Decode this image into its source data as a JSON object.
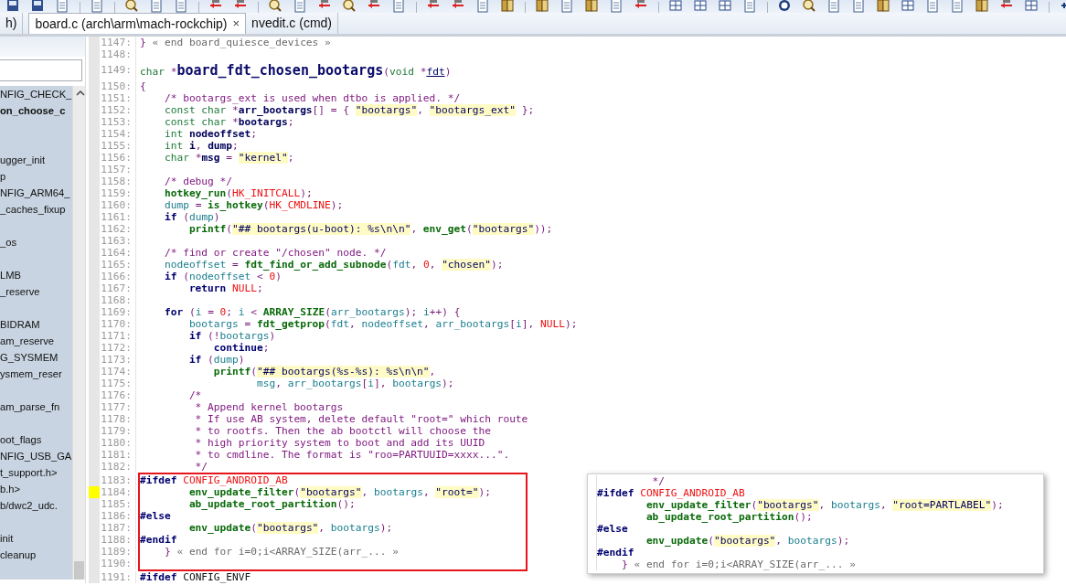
{
  "tabs": [
    {
      "label": "h)",
      "selected": false,
      "closable": false
    },
    {
      "label": "board.c (arch\\arm\\mach-rockchip)",
      "selected": true,
      "closable": true,
      "close_glyph": "×"
    },
    {
      "label": "nvedit.c (cmd)",
      "selected": false,
      "closable": false
    }
  ],
  "sidebar": {
    "items": [
      {
        "kind": "symbol",
        "text": "NFIG_CHECK_",
        "selected": false
      },
      {
        "kind": "symbol",
        "text": "on_choose_c",
        "selected": true
      },
      {
        "kind": "clipped"
      },
      {
        "kind": "clipped"
      },
      {
        "kind": "symbol",
        "text": "ugger_init",
        "selected": false
      },
      {
        "kind": "symbol",
        "text": "p",
        "selected": false
      },
      {
        "kind": "symbol",
        "text": "NFIG_ARM64_",
        "selected": false
      },
      {
        "kind": "symbol",
        "text": "_caches_fixup",
        "selected": false
      },
      {
        "kind": "clipped"
      },
      {
        "kind": "symbol",
        "text": "_os",
        "selected": false
      },
      {
        "kind": "clipped"
      },
      {
        "kind": "symbol",
        "text": "LMB",
        "selected": false
      },
      {
        "kind": "symbol",
        "text": "_reserve",
        "selected": false
      },
      {
        "kind": "clipped"
      },
      {
        "kind": "symbol",
        "text": "BIDRAM",
        "selected": false
      },
      {
        "kind": "symbol",
        "text": "am_reserve",
        "selected": false
      },
      {
        "kind": "symbol",
        "text": "G_SYSMEM",
        "selected": false
      },
      {
        "kind": "symbol",
        "text": "ysmem_reser",
        "selected": false
      },
      {
        "kind": "clipped"
      },
      {
        "kind": "symbol",
        "text": "am_parse_fn",
        "selected": false
      },
      {
        "kind": "clipped"
      },
      {
        "kind": "symbol",
        "text": "oot_flags",
        "selected": false
      },
      {
        "kind": "symbol",
        "text": "NFIG_USB_GA",
        "selected": false
      },
      {
        "kind": "symbol",
        "text": "t_support.h>",
        "selected": false
      },
      {
        "kind": "symbol",
        "text": "b.h>",
        "selected": false
      },
      {
        "kind": "symbol",
        "text": "b/dwc2_udc.",
        "selected": false
      },
      {
        "kind": "clipped"
      },
      {
        "kind": "symbol",
        "text": "init",
        "selected": false
      },
      {
        "kind": "symbol",
        "text": "cleanup",
        "selected": false
      }
    ]
  },
  "editor": {
    "sections": [
      {
        "kind": "plain",
        "lines": [
          {
            "number": "1147:",
            "bookmarked": false,
            "tokens": [
              {
                "kind": "p",
                "text": "} "
              },
              {
                "kind": "fold",
                "text": "« end board_quiesce_devices »"
              }
            ]
          },
          {
            "number": "1148:",
            "bookmarked": false
          },
          {
            "number": "1149:",
            "bookmarked": false,
            "tokens": [
              {
                "kind": "ty",
                "text": "char"
              },
              {
                "kind": "p",
                "text": " *"
              },
              {
                "kind": "fname",
                "text": "board_fdt_chosen_bootargs"
              },
              {
                "kind": "p",
                "text": "("
              },
              {
                "kind": "ty",
                "text": "void"
              },
              {
                "kind": "p",
                "text": " *"
              },
              {
                "kind": "param",
                "text": "fdt"
              },
              {
                "kind": "p",
                "text": ")"
              }
            ]
          },
          {
            "number": "1150:",
            "bookmarked": false,
            "tokens": [
              {
                "kind": "p",
                "text": "{"
              }
            ]
          },
          {
            "number": "1151:",
            "bookmarked": false,
            "tokens": [
              {
                "kind": "cm",
                "text": "    /* bootargs_ext is used when dtbo is applied. */"
              }
            ]
          },
          {
            "number": "1152:",
            "bookmarked": false,
            "tokens": [
              {
                "kind": "ty",
                "text": "    const char"
              },
              {
                "kind": "p",
                "text": " *"
              },
              {
                "kind": "def",
                "text": "arr_bootargs"
              },
              {
                "kind": "p",
                "text": "[] = { "
              },
              {
                "kind": "str",
                "text": "\"bootargs\""
              },
              {
                "kind": "p",
                "text": ", "
              },
              {
                "kind": "str",
                "text": "\"bootargs_ext\""
              },
              {
                "kind": "p",
                "text": " };"
              }
            ]
          },
          {
            "number": "1153:",
            "bookmarked": false,
            "tokens": [
              {
                "kind": "ty",
                "text": "    const char"
              },
              {
                "kind": "p",
                "text": " *"
              },
              {
                "kind": "def",
                "text": "bootargs"
              },
              {
                "kind": "p",
                "text": ";"
              }
            ]
          },
          {
            "number": "1154:",
            "bookmarked": false,
            "tokens": [
              {
                "kind": "ty",
                "text": "    int "
              },
              {
                "kind": "def",
                "text": "nodeoffset"
              },
              {
                "kind": "p",
                "text": ";"
              }
            ]
          },
          {
            "number": "1155:",
            "bookmarked": false,
            "tokens": [
              {
                "kind": "ty",
                "text": "    int "
              },
              {
                "kind": "def",
                "text": "i"
              },
              {
                "kind": "p",
                "text": ", "
              },
              {
                "kind": "def",
                "text": "dump"
              },
              {
                "kind": "p",
                "text": ";"
              }
            ]
          },
          {
            "number": "1156:",
            "bookmarked": false,
            "tokens": [
              {
                "kind": "ty",
                "text": "    char"
              },
              {
                "kind": "p",
                "text": " *"
              },
              {
                "kind": "def",
                "text": "msg"
              },
              {
                "kind": "p",
                "text": " = "
              },
              {
                "kind": "str",
                "text": "\"kernel\""
              },
              {
                "kind": "p",
                "text": ";"
              }
            ]
          },
          {
            "number": "1157:",
            "bookmarked": false
          },
          {
            "number": "1158:",
            "bookmarked": false,
            "tokens": [
              {
                "kind": "cm",
                "text": "    /* debug */"
              }
            ]
          },
          {
            "number": "1159:",
            "bookmarked": false,
            "tokens": [
              {
                "kind": "fn",
                "text": "    hotkey_run"
              },
              {
                "kind": "p",
                "text": "("
              },
              {
                "kind": "mac",
                "text": "HK_INITCALL"
              },
              {
                "kind": "p",
                "text": ");"
              }
            ]
          },
          {
            "number": "1160:",
            "bookmarked": false,
            "tokens": [
              {
                "kind": "id",
                "text": "    dump"
              },
              {
                "kind": "p",
                "text": " = "
              },
              {
                "kind": "fn",
                "text": "is_hotkey"
              },
              {
                "kind": "p",
                "text": "("
              },
              {
                "kind": "mac",
                "text": "HK_CMDLINE"
              },
              {
                "kind": "p",
                "text": ");"
              }
            ]
          },
          {
            "number": "1161:",
            "bookmarked": false,
            "tokens": [
              {
                "kind": "kw",
                "text": "    if"
              },
              {
                "kind": "p",
                "text": " ("
              },
              {
                "kind": "id",
                "text": "dump"
              },
              {
                "kind": "p",
                "text": ")"
              }
            ]
          },
          {
            "number": "1162:",
            "bookmarked": false,
            "tokens": [
              {
                "kind": "fn",
                "text": "        printf"
              },
              {
                "kind": "p",
                "text": "("
              },
              {
                "kind": "str",
                "text": "\"## bootargs(u-boot): %s\\n\\n\""
              },
              {
                "kind": "p",
                "text": ", "
              },
              {
                "kind": "fn",
                "text": "env_get"
              },
              {
                "kind": "p",
                "text": "("
              },
              {
                "kind": "str",
                "text": "\"bootargs\""
              },
              {
                "kind": "p",
                "text": "));"
              }
            ]
          },
          {
            "number": "1163:",
            "bookmarked": false
          },
          {
            "number": "1164:",
            "bookmarked": false,
            "tokens": [
              {
                "kind": "cm",
                "text": "    /* find or create \"/chosen\" node. */"
              }
            ]
          },
          {
            "number": "1165:",
            "bookmarked": false,
            "tokens": [
              {
                "kind": "id",
                "text": "    nodeoffset"
              },
              {
                "kind": "p",
                "text": " = "
              },
              {
                "kind": "fn",
                "text": "fdt_find_or_add_subnode"
              },
              {
                "kind": "p",
                "text": "("
              },
              {
                "kind": "id",
                "text": "fdt"
              },
              {
                "kind": "p",
                "text": ", "
              },
              {
                "kind": "mac",
                "text": "0"
              },
              {
                "kind": "p",
                "text": ", "
              },
              {
                "kind": "str",
                "text": "\"chosen\""
              },
              {
                "kind": "p",
                "text": ");"
              }
            ]
          },
          {
            "number": "1166:",
            "bookmarked": false,
            "tokens": [
              {
                "kind": "kw",
                "text": "    if"
              },
              {
                "kind": "p",
                "text": " ("
              },
              {
                "kind": "id",
                "text": "nodeoffset"
              },
              {
                "kind": "p",
                "text": " < "
              },
              {
                "kind": "mac",
                "text": "0"
              },
              {
                "kind": "p",
                "text": ")"
              }
            ]
          },
          {
            "number": "1167:",
            "bookmarked": false,
            "tokens": [
              {
                "kind": "kw",
                "text": "        return "
              },
              {
                "kind": "mac",
                "text": "NULL"
              },
              {
                "kind": "p",
                "text": ";"
              }
            ]
          },
          {
            "number": "1168:",
            "bookmarked": false
          },
          {
            "number": "1169:",
            "bookmarked": false,
            "tokens": [
              {
                "kind": "kw",
                "text": "    for"
              },
              {
                "kind": "p",
                "text": " ("
              },
              {
                "kind": "id",
                "text": "i"
              },
              {
                "kind": "p",
                "text": " = "
              },
              {
                "kind": "mac",
                "text": "0"
              },
              {
                "kind": "p",
                "text": "; "
              },
              {
                "kind": "id",
                "text": "i"
              },
              {
                "kind": "p",
                "text": " < "
              },
              {
                "kind": "fn",
                "text": "ARRAY_SIZE"
              },
              {
                "kind": "p",
                "text": "("
              },
              {
                "kind": "id",
                "text": "arr_bootargs"
              },
              {
                "kind": "p",
                "text": "); "
              },
              {
                "kind": "id",
                "text": "i"
              },
              {
                "kind": "p",
                "text": "++) {"
              }
            ]
          },
          {
            "number": "1170:",
            "bookmarked": false,
            "tokens": [
              {
                "kind": "id",
                "text": "        bootargs"
              },
              {
                "kind": "p",
                "text": " = "
              },
              {
                "kind": "fn",
                "text": "fdt_getprop"
              },
              {
                "kind": "p",
                "text": "("
              },
              {
                "kind": "id",
                "text": "fdt"
              },
              {
                "kind": "p",
                "text": ", "
              },
              {
                "kind": "id",
                "text": "nodeoffset"
              },
              {
                "kind": "p",
                "text": ", "
              },
              {
                "kind": "id",
                "text": "arr_bootargs"
              },
              {
                "kind": "p",
                "text": "["
              },
              {
                "kind": "id",
                "text": "i"
              },
              {
                "kind": "p",
                "text": "], "
              },
              {
                "kind": "mac",
                "text": "NULL"
              },
              {
                "kind": "p",
                "text": ");"
              }
            ]
          },
          {
            "number": "1171:",
            "bookmarked": false,
            "tokens": [
              {
                "kind": "kw",
                "text": "        if"
              },
              {
                "kind": "p",
                "text": " (!"
              },
              {
                "kind": "id",
                "text": "bootargs"
              },
              {
                "kind": "p",
                "text": ")"
              }
            ]
          },
          {
            "number": "1172:",
            "bookmarked": false,
            "tokens": [
              {
                "kind": "kw",
                "text": "            continue"
              },
              {
                "kind": "p",
                "text": ";"
              }
            ]
          },
          {
            "number": "1173:",
            "bookmarked": false,
            "tokens": [
              {
                "kind": "kw",
                "text": "        if"
              },
              {
                "kind": "p",
                "text": " ("
              },
              {
                "kind": "id",
                "text": "dump"
              },
              {
                "kind": "p",
                "text": ")"
              }
            ]
          },
          {
            "number": "1174:",
            "bookmarked": false,
            "tokens": [
              {
                "kind": "fn",
                "text": "            printf"
              },
              {
                "kind": "p",
                "text": "("
              },
              {
                "kind": "str",
                "text": "\"## bootargs(%s-%s): %s\\n\\n\""
              },
              {
                "kind": "p",
                "text": ","
              }
            ]
          },
          {
            "number": "1175:",
            "bookmarked": false,
            "tokens": [
              {
                "kind": "id",
                "text": "                   msg"
              },
              {
                "kind": "p",
                "text": ", "
              },
              {
                "kind": "id",
                "text": "arr_bootargs"
              },
              {
                "kind": "p",
                "text": "["
              },
              {
                "kind": "id",
                "text": "i"
              },
              {
                "kind": "p",
                "text": "], "
              },
              {
                "kind": "id",
                "text": "bootargs"
              },
              {
                "kind": "p",
                "text": ");"
              }
            ]
          },
          {
            "number": "1176:",
            "bookmarked": false,
            "tokens": [
              {
                "kind": "cm",
                "text": "        /*"
              }
            ]
          },
          {
            "number": "1177:",
            "bookmarked": false,
            "tokens": [
              {
                "kind": "cm",
                "text": "         * Append kernel bootargs"
              }
            ]
          },
          {
            "number": "1178:",
            "bookmarked": false,
            "tokens": [
              {
                "kind": "cm",
                "text": "         * If use AB system, delete default \"root=\" which route"
              }
            ]
          },
          {
            "number": "1179:",
            "bookmarked": false,
            "tokens": [
              {
                "kind": "cm",
                "text": "         * to rootfs. Then the ab bootctl will choose the"
              }
            ]
          },
          {
            "number": "1180:",
            "bookmarked": false,
            "tokens": [
              {
                "kind": "cm",
                "text": "         * high priority system to boot and add its UUID"
              }
            ]
          },
          {
            "number": "1181:",
            "bookmarked": false,
            "tokens": [
              {
                "kind": "cm",
                "text": "         * to cmdline. The format is \"roo=PARTUUID=xxxx...\"."
              }
            ]
          },
          {
            "number": "1182:",
            "bookmarked": false,
            "tokens": [
              {
                "kind": "cm",
                "text": "         */"
              }
            ]
          }
        ]
      },
      {
        "kind": "boxed",
        "lines": [
          {
            "number": "1183:",
            "bookmarked": false,
            "tokens": [
              {
                "kind": "kw",
                "text": "#ifdef "
              },
              {
                "kind": "mac",
                "text": "CONFIG_ANDROID_AB"
              }
            ]
          },
          {
            "number": "1184:",
            "bookmarked": true,
            "tokens": [
              {
                "kind": "fn",
                "text": "        env_update_filter"
              },
              {
                "kind": "p",
                "text": "("
              },
              {
                "kind": "str",
                "text": "\"bootargs\""
              },
              {
                "kind": "p",
                "text": ", "
              },
              {
                "kind": "id",
                "text": "bootargs"
              },
              {
                "kind": "p",
                "text": ", "
              },
              {
                "kind": "str",
                "text": "\"root=\""
              },
              {
                "kind": "p",
                "text": ");"
              }
            ]
          },
          {
            "number": "1185:",
            "bookmarked": false,
            "tokens": [
              {
                "kind": "fn",
                "text": "        ab_update_root_partition"
              },
              {
                "kind": "p",
                "text": "();"
              }
            ]
          },
          {
            "number": "1186:",
            "bookmarked": false,
            "tokens": [
              {
                "kind": "kw",
                "text": "#else"
              }
            ]
          },
          {
            "number": "1187:",
            "bookmarked": false,
            "tokens": [
              {
                "kind": "fn",
                "text": "        env_update"
              },
              {
                "kind": "p",
                "text": "("
              },
              {
                "kind": "str",
                "text": "\"bootargs\""
              },
              {
                "kind": "p",
                "text": ", "
              },
              {
                "kind": "id",
                "text": "bootargs"
              },
              {
                "kind": "p",
                "text": ");"
              }
            ]
          },
          {
            "number": "1188:",
            "bookmarked": false,
            "tokens": [
              {
                "kind": "kw",
                "text": "#endif"
              }
            ]
          },
          {
            "number": "1189:",
            "bookmarked": false,
            "tokens": [
              {
                "kind": "p",
                "text": "    } "
              },
              {
                "kind": "fold",
                "text": "« end for i=0;i<ARRAY_SIZE(arr_... »"
              }
            ]
          },
          {
            "number": "1190:",
            "bookmarked": false
          }
        ]
      },
      {
        "kind": "plain",
        "lines": [
          {
            "number": "1191:",
            "bookmarked": false,
            "tokens": [
              {
                "kind": "kw",
                "text": "#ifdef "
              },
              {
                "kind": "plain",
                "text": "CONFIG_ENVF"
              }
            ]
          }
        ]
      }
    ]
  },
  "preview_popup": {
    "lines": [
      {
        "tokens": [
          {
            "kind": "cm",
            "text": "         */"
          }
        ]
      },
      {
        "tokens": [
          {
            "kind": "kw",
            "text": "#ifdef "
          },
          {
            "kind": "mac",
            "text": "CONFIG_ANDROID_AB"
          }
        ]
      },
      {
        "tokens": [
          {
            "kind": "fn",
            "text": "        env_update_filter"
          },
          {
            "kind": "p",
            "text": "("
          },
          {
            "kind": "str",
            "text": "\"bootargs\""
          },
          {
            "kind": "p",
            "text": ", "
          },
          {
            "kind": "id",
            "text": "bootargs"
          },
          {
            "kind": "p",
            "text": ", "
          },
          {
            "kind": "str",
            "text": "\"root=PARTLABEL\""
          },
          {
            "kind": "p",
            "text": ");"
          }
        ]
      },
      {
        "tokens": [
          {
            "kind": "fn",
            "text": "        ab_update_root_partition"
          },
          {
            "kind": "p",
            "text": "();"
          }
        ]
      },
      {
        "tokens": [
          {
            "kind": "kw",
            "text": "#else"
          }
        ]
      },
      {
        "tokens": [
          {
            "kind": "fn",
            "text": "        env_update"
          },
          {
            "kind": "p",
            "text": "("
          },
          {
            "kind": "str",
            "text": "\"bootargs\""
          },
          {
            "kind": "p",
            "text": ", "
          },
          {
            "kind": "id",
            "text": "bootargs"
          },
          {
            "kind": "p",
            "text": ");"
          }
        ]
      },
      {
        "tokens": [
          {
            "kind": "kw",
            "text": "#endif"
          }
        ]
      },
      {
        "tokens": [
          {
            "kind": "p",
            "text": "    } "
          },
          {
            "kind": "fold",
            "text": "« end for i=0;i<ARRAY_SIZE(arr_... »"
          }
        ]
      }
    ]
  }
}
